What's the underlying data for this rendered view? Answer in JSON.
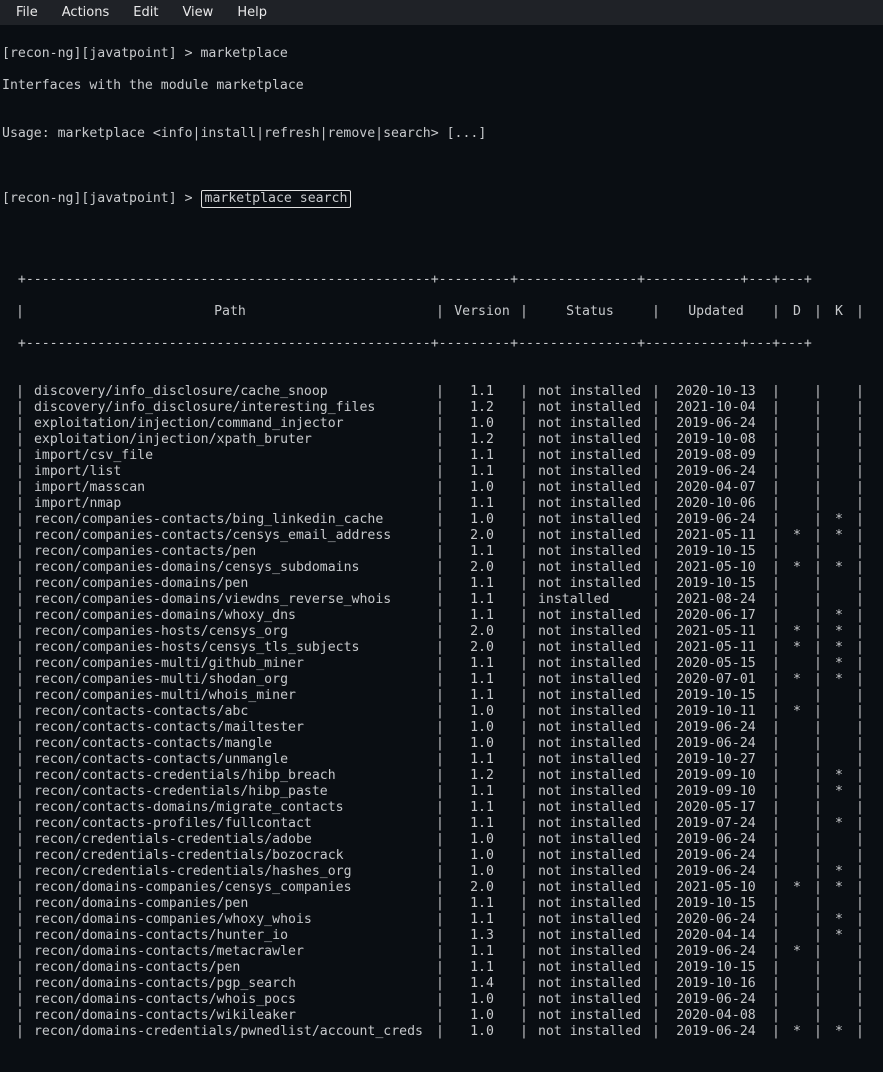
{
  "menu": {
    "file": "File",
    "actions": "Actions",
    "edit": "Edit",
    "view": "View",
    "help": "Help"
  },
  "prompt": {
    "line1": "[recon-ng][javatpoint] > marketplace",
    "line2": "Interfaces with the module marketplace",
    "blank": "",
    "usage": "Usage: marketplace <info|install|refresh|remove|search> [...]",
    "line3_prefix": "[recon-ng][javatpoint] > ",
    "command": "marketplace search"
  },
  "table": {
    "border_top": "  +---------------------------------------------------+---------+---------------+------------+---+---+",
    "border_mid": "  +---------------------------------------------------+---------+---------------+------------+---+---+",
    "headers": {
      "path": "Path",
      "version": "Version",
      "status": "Status",
      "updated": "Updated",
      "d": "D",
      "k": "K"
    }
  },
  "modules": [
    {
      "path": "discovery/info_disclosure/cache_snoop",
      "version": "1.1",
      "status": "not installed",
      "updated": "2020-10-13",
      "d": "",
      "k": ""
    },
    {
      "path": "discovery/info_disclosure/interesting_files",
      "version": "1.2",
      "status": "not installed",
      "updated": "2021-10-04",
      "d": "",
      "k": ""
    },
    {
      "path": "exploitation/injection/command_injector",
      "version": "1.0",
      "status": "not installed",
      "updated": "2019-06-24",
      "d": "",
      "k": ""
    },
    {
      "path": "exploitation/injection/xpath_bruter",
      "version": "1.2",
      "status": "not installed",
      "updated": "2019-10-08",
      "d": "",
      "k": ""
    },
    {
      "path": "import/csv_file",
      "version": "1.1",
      "status": "not installed",
      "updated": "2019-08-09",
      "d": "",
      "k": ""
    },
    {
      "path": "import/list",
      "version": "1.1",
      "status": "not installed",
      "updated": "2019-06-24",
      "d": "",
      "k": ""
    },
    {
      "path": "import/masscan",
      "version": "1.0",
      "status": "not installed",
      "updated": "2020-04-07",
      "d": "",
      "k": ""
    },
    {
      "path": "import/nmap",
      "version": "1.1",
      "status": "not installed",
      "updated": "2020-10-06",
      "d": "",
      "k": ""
    },
    {
      "path": "recon/companies-contacts/bing_linkedin_cache",
      "version": "1.0",
      "status": "not installed",
      "updated": "2019-06-24",
      "d": "",
      "k": "*"
    },
    {
      "path": "recon/companies-contacts/censys_email_address",
      "version": "2.0",
      "status": "not installed",
      "updated": "2021-05-11",
      "d": "*",
      "k": "*"
    },
    {
      "path": "recon/companies-contacts/pen",
      "version": "1.1",
      "status": "not installed",
      "updated": "2019-10-15",
      "d": "",
      "k": ""
    },
    {
      "path": "recon/companies-domains/censys_subdomains",
      "version": "2.0",
      "status": "not installed",
      "updated": "2021-05-10",
      "d": "*",
      "k": "*"
    },
    {
      "path": "recon/companies-domains/pen",
      "version": "1.1",
      "status": "not installed",
      "updated": "2019-10-15",
      "d": "",
      "k": ""
    },
    {
      "path": "recon/companies-domains/viewdns_reverse_whois",
      "version": "1.1",
      "status": "installed",
      "updated": "2021-08-24",
      "d": "",
      "k": ""
    },
    {
      "path": "recon/companies-domains/whoxy_dns",
      "version": "1.1",
      "status": "not installed",
      "updated": "2020-06-17",
      "d": "",
      "k": "*"
    },
    {
      "path": "recon/companies-hosts/censys_org",
      "version": "2.0",
      "status": "not installed",
      "updated": "2021-05-11",
      "d": "*",
      "k": "*"
    },
    {
      "path": "recon/companies-hosts/censys_tls_subjects",
      "version": "2.0",
      "status": "not installed",
      "updated": "2021-05-11",
      "d": "*",
      "k": "*"
    },
    {
      "path": "recon/companies-multi/github_miner",
      "version": "1.1",
      "status": "not installed",
      "updated": "2020-05-15",
      "d": "",
      "k": "*"
    },
    {
      "path": "recon/companies-multi/shodan_org",
      "version": "1.1",
      "status": "not installed",
      "updated": "2020-07-01",
      "d": "*",
      "k": "*"
    },
    {
      "path": "recon/companies-multi/whois_miner",
      "version": "1.1",
      "status": "not installed",
      "updated": "2019-10-15",
      "d": "",
      "k": ""
    },
    {
      "path": "recon/contacts-contacts/abc",
      "version": "1.0",
      "status": "not installed",
      "updated": "2019-10-11",
      "d": "*",
      "k": ""
    },
    {
      "path": "recon/contacts-contacts/mailtester",
      "version": "1.0",
      "status": "not installed",
      "updated": "2019-06-24",
      "d": "",
      "k": ""
    },
    {
      "path": "recon/contacts-contacts/mangle",
      "version": "1.0",
      "status": "not installed",
      "updated": "2019-06-24",
      "d": "",
      "k": ""
    },
    {
      "path": "recon/contacts-contacts/unmangle",
      "version": "1.1",
      "status": "not installed",
      "updated": "2019-10-27",
      "d": "",
      "k": ""
    },
    {
      "path": "recon/contacts-credentials/hibp_breach",
      "version": "1.2",
      "status": "not installed",
      "updated": "2019-09-10",
      "d": "",
      "k": "*"
    },
    {
      "path": "recon/contacts-credentials/hibp_paste",
      "version": "1.1",
      "status": "not installed",
      "updated": "2019-09-10",
      "d": "",
      "k": "*"
    },
    {
      "path": "recon/contacts-domains/migrate_contacts",
      "version": "1.1",
      "status": "not installed",
      "updated": "2020-05-17",
      "d": "",
      "k": ""
    },
    {
      "path": "recon/contacts-profiles/fullcontact",
      "version": "1.1",
      "status": "not installed",
      "updated": "2019-07-24",
      "d": "",
      "k": "*"
    },
    {
      "path": "recon/credentials-credentials/adobe",
      "version": "1.0",
      "status": "not installed",
      "updated": "2019-06-24",
      "d": "",
      "k": ""
    },
    {
      "path": "recon/credentials-credentials/bozocrack",
      "version": "1.0",
      "status": "not installed",
      "updated": "2019-06-24",
      "d": "",
      "k": ""
    },
    {
      "path": "recon/credentials-credentials/hashes_org",
      "version": "1.0",
      "status": "not installed",
      "updated": "2019-06-24",
      "d": "",
      "k": "*"
    },
    {
      "path": "recon/domains-companies/censys_companies",
      "version": "2.0",
      "status": "not installed",
      "updated": "2021-05-10",
      "d": "*",
      "k": "*"
    },
    {
      "path": "recon/domains-companies/pen",
      "version": "1.1",
      "status": "not installed",
      "updated": "2019-10-15",
      "d": "",
      "k": ""
    },
    {
      "path": "recon/domains-companies/whoxy_whois",
      "version": "1.1",
      "status": "not installed",
      "updated": "2020-06-24",
      "d": "",
      "k": "*"
    },
    {
      "path": "recon/domains-contacts/hunter_io",
      "version": "1.3",
      "status": "not installed",
      "updated": "2020-04-14",
      "d": "",
      "k": "*"
    },
    {
      "path": "recon/domains-contacts/metacrawler",
      "version": "1.1",
      "status": "not installed",
      "updated": "2019-06-24",
      "d": "*",
      "k": ""
    },
    {
      "path": "recon/domains-contacts/pen",
      "version": "1.1",
      "status": "not installed",
      "updated": "2019-10-15",
      "d": "",
      "k": ""
    },
    {
      "path": "recon/domains-contacts/pgp_search",
      "version": "1.4",
      "status": "not installed",
      "updated": "2019-10-16",
      "d": "",
      "k": ""
    },
    {
      "path": "recon/domains-contacts/whois_pocs",
      "version": "1.0",
      "status": "not installed",
      "updated": "2019-06-24",
      "d": "",
      "k": ""
    },
    {
      "path": "recon/domains-contacts/wikileaker",
      "version": "1.0",
      "status": "not installed",
      "updated": "2020-04-08",
      "d": "",
      "k": ""
    },
    {
      "path": "recon/domains-credentials/pwnedlist/account_creds",
      "version": "1.0",
      "status": "not installed",
      "updated": "2019-06-24",
      "d": "*",
      "k": "*"
    }
  ]
}
